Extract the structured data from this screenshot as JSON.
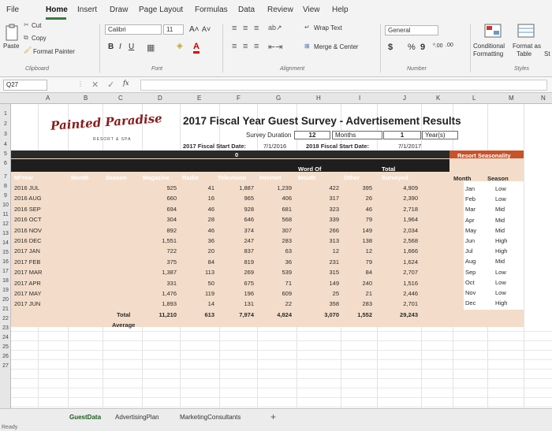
{
  "menu": [
    "File",
    "Home",
    "Insert",
    "Draw",
    "Page Layout",
    "Formulas",
    "Data",
    "Review",
    "View",
    "Help"
  ],
  "ribbon": {
    "paste": "Paste",
    "cut": "Cut",
    "copy": "Copy",
    "format_painter": "Format Painter",
    "clipboard": "Clipboard",
    "font_name": "Calibri",
    "font_size": "11",
    "grow": "A˄",
    "shrink": "A˅",
    "bold": "B",
    "italic": "I",
    "underline": "U",
    "font_group": "Font",
    "wrap_text": "Wrap Text",
    "merge_center": "Merge & Center",
    "alignment": "Alignment",
    "number_format": "General",
    "dollar": "$",
    "percent": "%",
    "comma": "9",
    "inc_dec": "⁰.00",
    "dec_dec": ".00",
    "number": "Number",
    "conditional": "Conditional",
    "formatting": "Formatting",
    "format_as": "Format as",
    "table": "Table",
    "styles": "Styles",
    "st": "St"
  },
  "formula": {
    "cell": "Q27",
    "fx": "fx"
  },
  "columns": [
    "A",
    "B",
    "C",
    "D",
    "E",
    "F",
    "G",
    "H",
    "I",
    "J",
    "K",
    "L",
    "M",
    "N"
  ],
  "rows": [
    "1",
    "2",
    "3",
    "4",
    "5",
    "6",
    "7",
    "8",
    "9",
    "10",
    "11",
    "12",
    "13",
    "14",
    "15",
    "16",
    "17",
    "18",
    "19",
    "20",
    "21",
    "22",
    "23",
    "24",
    "25",
    "26",
    "27"
  ],
  "logo": {
    "name": "Painted Paradise",
    "sub": "RESORT & SPA"
  },
  "title": "2017 Fiscal Year Guest Survey - Advertisement Results",
  "survey_duration": {
    "label": "Survey Duration",
    "value": "12",
    "unit": "Months",
    "years_val": "1",
    "years_unit": "Year(s)"
  },
  "start": {
    "label": "2017 Fiscal Start Date:",
    "value": "7/1/2016"
  },
  "fiscal2018": {
    "label": "2018 Fiscal Start Date:",
    "value": "7/1/2017"
  },
  "zero": "0",
  "headers": {
    "my": "M/Year",
    "month": "Month",
    "season": "Season",
    "magazine": "Magazine",
    "radio": "Radio",
    "tv": "Television",
    "internet": "Internet",
    "wom": "Word Of Mouth",
    "wom1": "Word Of",
    "wom2": "Mouth",
    "other": "Other",
    "total1": "Total",
    "total2": "Surveyed"
  },
  "data_rows": [
    [
      "2016 JUL",
      "925",
      "41",
      "1,887",
      "1,239",
      "422",
      "395",
      "4,909"
    ],
    [
      "2016 AUG",
      "660",
      "16",
      "965",
      "406",
      "317",
      "26",
      "2,390"
    ],
    [
      "2016 SEP",
      "694",
      "46",
      "928",
      "681",
      "323",
      "46",
      "2,718"
    ],
    [
      "2016 OCT",
      "304",
      "28",
      "646",
      "568",
      "339",
      "79",
      "1,964"
    ],
    [
      "2016 NOV",
      "892",
      "46",
      "374",
      "307",
      "266",
      "149",
      "2,034"
    ],
    [
      "2016 DEC",
      "1,551",
      "36",
      "247",
      "283",
      "313",
      "138",
      "2,568"
    ],
    [
      "2017 JAN",
      "722",
      "20",
      "837",
      "63",
      "12",
      "12",
      "1,666"
    ],
    [
      "2017 FEB",
      "375",
      "84",
      "819",
      "36",
      "231",
      "79",
      "1,624"
    ],
    [
      "2017 MAR",
      "1,387",
      "113",
      "269",
      "539",
      "315",
      "84",
      "2,707"
    ],
    [
      "2017 APR",
      "331",
      "50",
      "675",
      "71",
      "149",
      "240",
      "1,516"
    ],
    [
      "2017 MAY",
      "1,476",
      "119",
      "196",
      "609",
      "25",
      "21",
      "2,446"
    ],
    [
      "2017 JUN",
      "1,893",
      "14",
      "131",
      "22",
      "358",
      "283",
      "2,701"
    ]
  ],
  "totals": {
    "label": "Total",
    "values": [
      "11,210",
      "613",
      "7,974",
      "4,824",
      "3,070",
      "1,552",
      "29,243"
    ]
  },
  "average": "Average",
  "seasonality": {
    "title": "Resort Seasonality",
    "month_h": "Month",
    "season_h": "Season",
    "rows": [
      [
        "Jan",
        "Low"
      ],
      [
        "Feb",
        "Low"
      ],
      [
        "Mar",
        "Mid"
      ],
      [
        "Apr",
        "Mid"
      ],
      [
        "May",
        "Mid"
      ],
      [
        "Jun",
        "High"
      ],
      [
        "Jul",
        "High"
      ],
      [
        "Aug",
        "Mid"
      ],
      [
        "Sep",
        "Low"
      ],
      [
        "Oct",
        "Low"
      ],
      [
        "Nov",
        "Low"
      ],
      [
        "Dec",
        "High"
      ]
    ]
  },
  "tabs": [
    "GuestData",
    "AdvertisingPlan",
    "MarketingConsultants"
  ],
  "add_sheet": "+",
  "status": "Ready"
}
